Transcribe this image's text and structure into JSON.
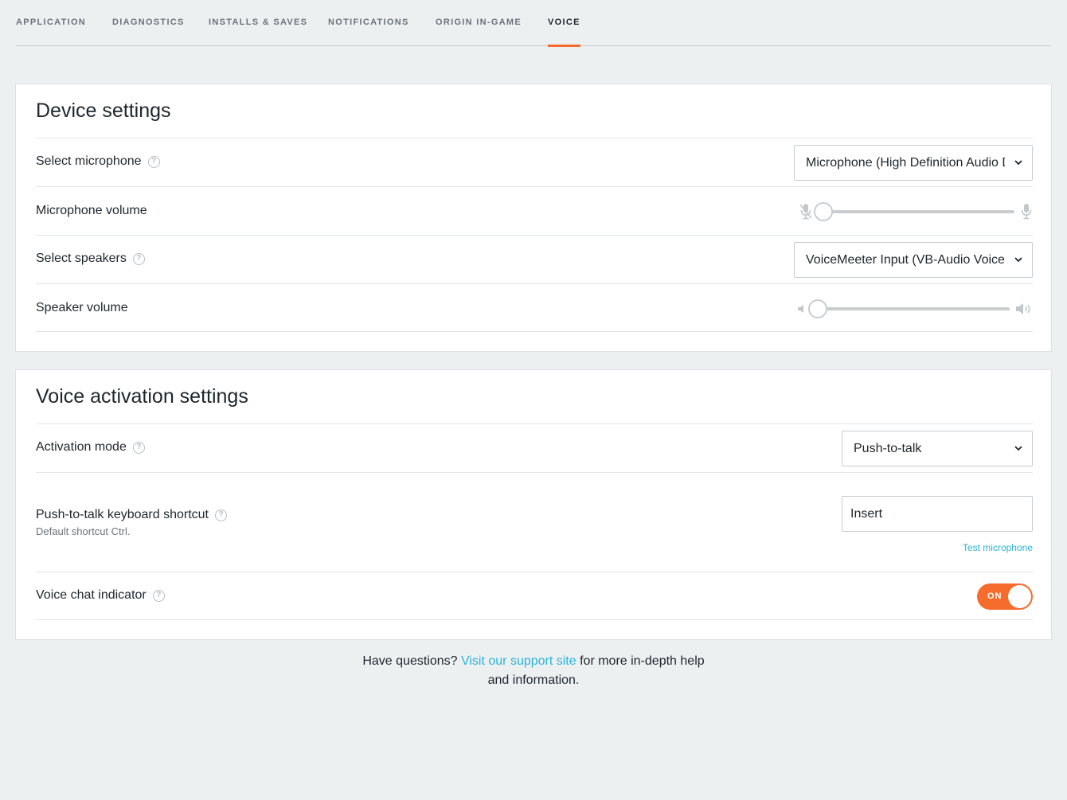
{
  "tabs": {
    "application": "APPLICATION",
    "diagnostics": "DIAGNOSTICS",
    "installs_saves": "INSTALLS & SAVES",
    "notifications": "NOTIFICATIONS",
    "origin_in_game": "ORIGIN IN-GAME",
    "voice": "VOICE",
    "active": "VOICE"
  },
  "device_settings": {
    "title": "Device settings",
    "microphone": {
      "label": "Select microphone",
      "value": "Microphone (High Definition Audio Device)"
    },
    "microphone_volume": {
      "label": "Microphone volume",
      "level": 0.0
    },
    "speakers": {
      "label": "Select speakers",
      "value": "VoiceMeeter Input (VB-Audio VoiceMeeter VAIO)"
    },
    "speaker_volume": {
      "label": "Speaker volume",
      "level": 0.0
    }
  },
  "voice_activation": {
    "title": "Voice activation settings",
    "activation_mode": {
      "label": "Activation mode",
      "value": "Push-to-talk"
    },
    "ptt_shortcut": {
      "label": "Push-to-talk keyboard shortcut",
      "sublabel": "Default shortcut Ctrl.",
      "value": "Insert",
      "test_link": "Test microphone"
    },
    "voice_chat_indicator": {
      "label": "Voice chat indicator",
      "toggle_text": "ON",
      "state": true
    }
  },
  "footer": {
    "prefix": "Have questions?",
    "link": "Visit our support site",
    "suffix": "for more in-depth help and information."
  },
  "colors": {
    "accent": "#f56c2d",
    "link": "#2bb5d9",
    "background": "#edf0f1"
  }
}
